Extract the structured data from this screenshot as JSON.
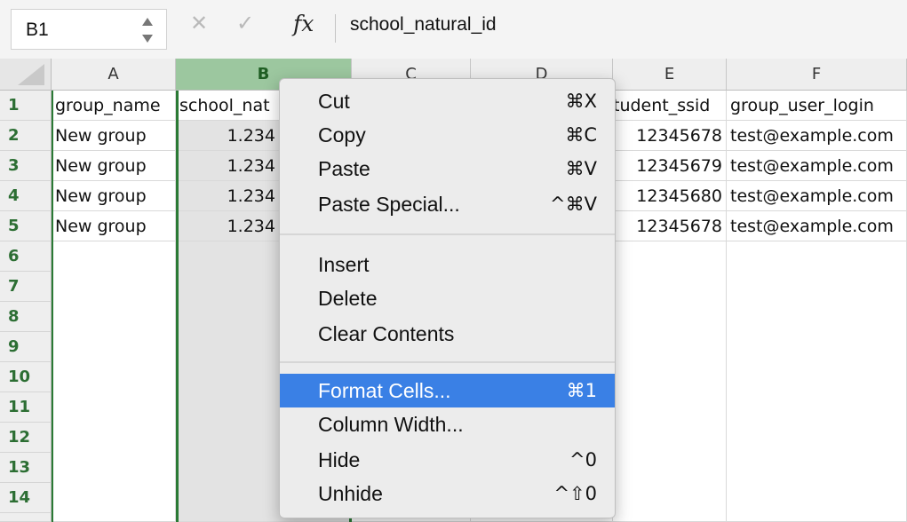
{
  "formula_bar": {
    "cell_ref": "B1",
    "cancel_glyph": "✕",
    "confirm_glyph": "✓",
    "fx_label": "fx",
    "formula": "school_natural_id"
  },
  "grid": {
    "columns": [
      "A",
      "B",
      "C",
      "D",
      "E",
      "F"
    ],
    "rows": [
      "1",
      "2",
      "3",
      "4",
      "5",
      "6",
      "7",
      "8",
      "9",
      "10",
      "11",
      "12",
      "13",
      "14"
    ],
    "col_a": [
      "group_name",
      "New group",
      "New group",
      "New group",
      "New group"
    ],
    "col_b": [
      "school_nat",
      "1.234",
      "1.234",
      "1.234",
      "1.234"
    ],
    "col_e": [
      "tudent_ssid",
      "12345678",
      "12345679",
      "12345680",
      "12345678"
    ],
    "col_f": [
      "group_user_login",
      "test@example.com",
      "test@example.com",
      "test@example.com",
      "test@example.com"
    ]
  },
  "context_menu": {
    "cut": {
      "label": "Cut",
      "shortcut": "⌘X"
    },
    "copy": {
      "label": "Copy",
      "shortcut": "⌘C"
    },
    "paste": {
      "label": "Paste",
      "shortcut": "⌘V"
    },
    "paste_special": {
      "label": "Paste Special...",
      "shortcut": "^⌘V"
    },
    "insert": {
      "label": "Insert"
    },
    "delete": {
      "label": "Delete"
    },
    "clear_contents": {
      "label": "Clear Contents"
    },
    "format_cells": {
      "label": "Format Cells...",
      "shortcut": "⌘1"
    },
    "column_width": {
      "label": "Column Width..."
    },
    "hide": {
      "label": "Hide",
      "shortcut": "^0"
    },
    "unhide": {
      "label": "Unhide",
      "shortcut": "^⇧0"
    }
  },
  "colors": {
    "selection_green": "#2b7a35",
    "menu_highlight": "#3a80e5"
  }
}
